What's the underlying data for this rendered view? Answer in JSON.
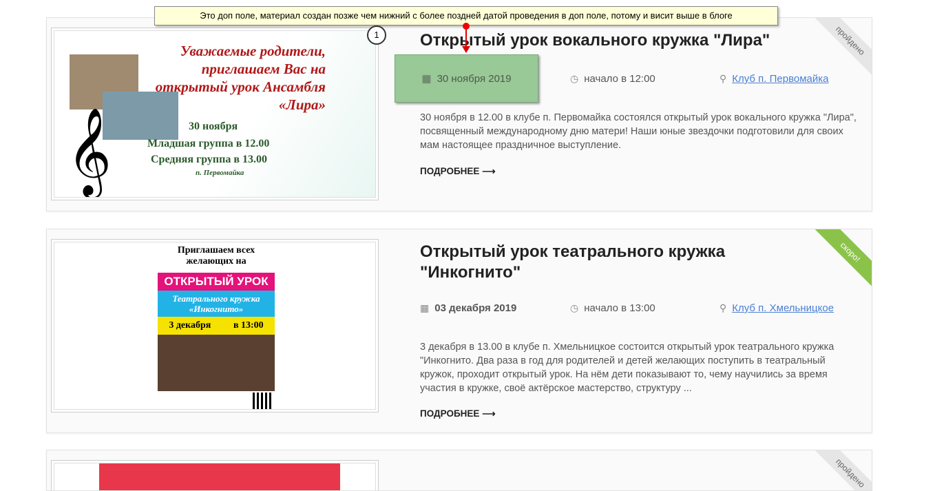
{
  "annotation": {
    "tooltip": "Это доп поле, материал создан позже чем нижний с более поздней датой проведения в доп поле, потому и висит выше в блоге",
    "marker": "1"
  },
  "posts": [
    {
      "title": "Открытый урок вокального кружка \"Лира\"",
      "date": "30 ноября 2019",
      "time": "начало в 12:00",
      "place": "Клуб п. Первомайка",
      "description": "30 ноября в 12.00 в клубе п. Первомайка состоялся открытый урок вокального кружка \"Лира\", посвященный международному дню матери! Наши юные звездочки подготовили для своих мам настоящее праздничное выступление.",
      "more": "ПОДРОБНЕЕ",
      "ribbon": "пройдено",
      "poster": {
        "heading": "Уважаемые родители, приглашаем Вас на открытый урок Ансамбля «Лира»",
        "date": "30 ноября",
        "line1": "Младшая группа в 12.00",
        "line2": "Средняя группа в 13.00",
        "place": "п. Первомайка"
      }
    },
    {
      "title": "Открытый урок театрального кружка \"Инкогнито\"",
      "date": "03 декабря 2019",
      "time": "начало в 13:00",
      "place": "Клуб п. Хмельницкое",
      "description": "3 декабря в 13.00 в клубе п. Хмельницкое состоится открытый урок театрального кружка \"Инкогнито. Два раза в год для родителей и детей желающих поступить в театральный кружок, проходит открытый урок. На нём дети показывают то, чему научились за время участия в кружке, своё актёрское мастерство, структуру ...",
      "more": "ПОДРОБНЕЕ",
      "ribbon": "скоро!",
      "poster": {
        "top": "Приглашаем всех желающих на",
        "banner": "ОТКРЫТЫЙ УРОК",
        "sub": "Театрального кружка «Инкогнито»",
        "date": "3 декабря",
        "time": "в 13:00"
      }
    },
    {
      "ribbon": "пройдено"
    }
  ],
  "colors": {
    "highlight": "#98c996",
    "link": "#4a7fd4",
    "ribbon_done": "#e6e6e6",
    "ribbon_soon": "#8bc34a"
  }
}
